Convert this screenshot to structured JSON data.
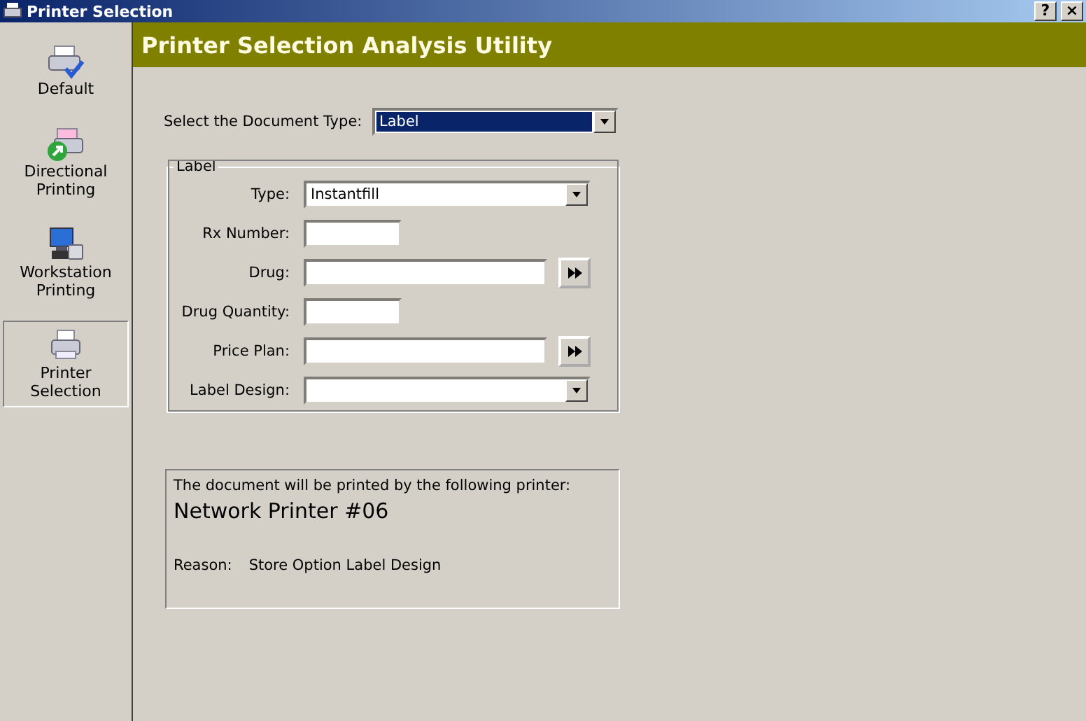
{
  "window": {
    "title": "Printer Selection",
    "buttons": [
      "?",
      "×"
    ]
  },
  "sidebar": {
    "items": [
      {
        "label": "Default",
        "kind": "printer-check",
        "selected": false
      },
      {
        "label": "Directional Printing",
        "kind": "printer-arrow",
        "selected": false
      },
      {
        "label": "Workstation Printing",
        "kind": "computer",
        "selected": false
      },
      {
        "label": "Printer Selection",
        "kind": "printer",
        "selected": true
      }
    ]
  },
  "header": {
    "title": "Printer Selection Analysis Utility"
  },
  "document_type": {
    "label": "Select the Document Type:",
    "value": "Label",
    "focused": true
  },
  "group": {
    "title": "Label",
    "fields": [
      {
        "label": "Type:",
        "kind": "combo",
        "value": "Instantfill"
      },
      {
        "label": "Rx Number:",
        "kind": "short"
      },
      {
        "label": "Drug:",
        "kind": "lookup"
      },
      {
        "label": "Drug Quantity:",
        "kind": "short"
      },
      {
        "label": "Price Plan:",
        "kind": "lookup"
      },
      {
        "label": "Label Design:",
        "kind": "combo"
      }
    ]
  },
  "result": {
    "intro": "The document will be printed by the following printer:",
    "printer": "Network Printer #06",
    "reason_label": "Reason:",
    "reason": "Store Option Label Design"
  }
}
